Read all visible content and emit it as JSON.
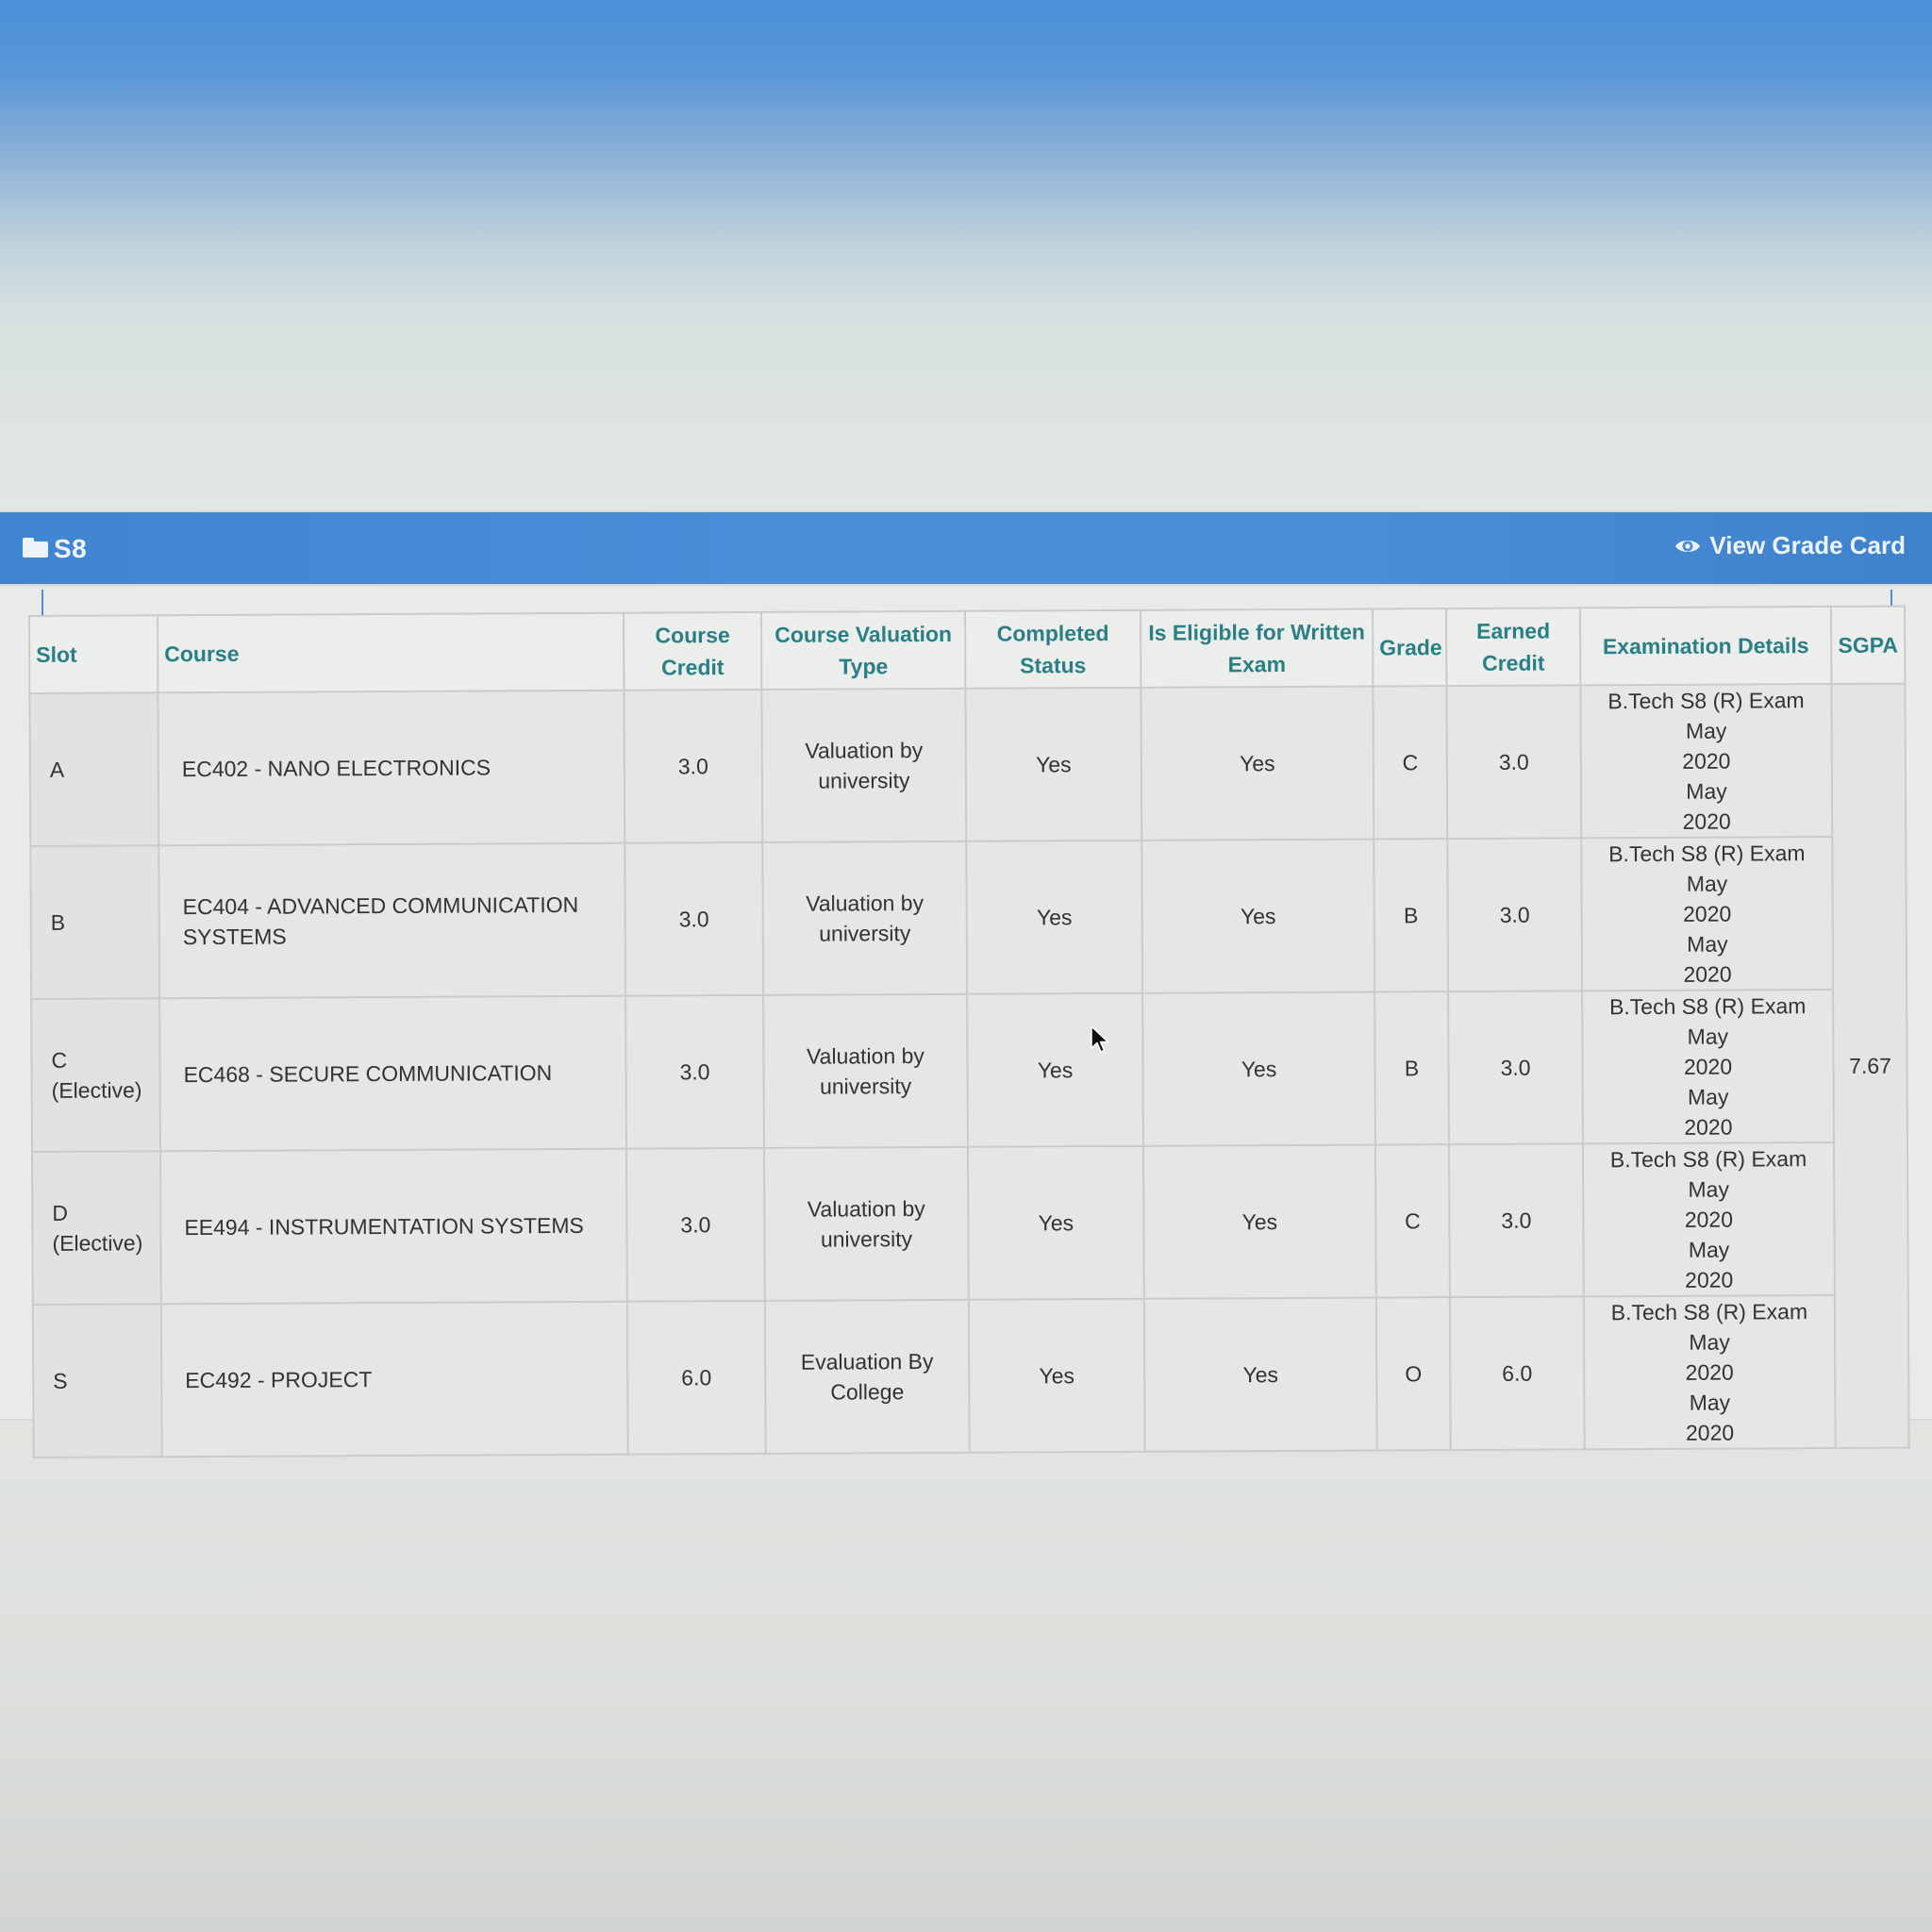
{
  "panel": {
    "title": "S8",
    "view_link": "View Grade Card"
  },
  "table": {
    "headers": {
      "slot": "Slot",
      "course": "Course",
      "course_credit": "Course Credit",
      "valuation_type": "Course Valuation Type",
      "completed_status": "Completed Status",
      "eligible": "Is Eligible for Written Exam",
      "grade": "Grade",
      "earned_credit": "Earned Credit",
      "exam_details": "Examination Details",
      "sgpa": "SGPA"
    },
    "sgpa": "7.67",
    "rows": [
      {
        "slot_code": "A",
        "slot_note": "",
        "course": "EC402 - NANO ELECTRONICS",
        "credit": "3.0",
        "valuation_line1": "Valuation by",
        "valuation_line2": "university",
        "completed": "Yes",
        "eligible": "Yes",
        "grade": "C",
        "earned": "3.0",
        "exam_line1": "B.Tech S8 (R) Exam May",
        "exam_line2": "2020",
        "exam_line3": "May",
        "exam_line4": "2020"
      },
      {
        "slot_code": "B",
        "slot_note": "",
        "course": "EC404 - ADVANCED COMMUNICATION SYSTEMS",
        "credit": "3.0",
        "valuation_line1": "Valuation by",
        "valuation_line2": "university",
        "completed": "Yes",
        "eligible": "Yes",
        "grade": "B",
        "earned": "3.0",
        "exam_line1": "B.Tech S8 (R) Exam May",
        "exam_line2": "2020",
        "exam_line3": "May",
        "exam_line4": "2020"
      },
      {
        "slot_code": "C",
        "slot_note": "(Elective)",
        "course": "EC468 - SECURE COMMUNICATION",
        "credit": "3.0",
        "valuation_line1": "Valuation by",
        "valuation_line2": "university",
        "completed": "Yes",
        "eligible": "Yes",
        "grade": "B",
        "earned": "3.0",
        "exam_line1": "B.Tech S8 (R) Exam May",
        "exam_line2": "2020",
        "exam_line3": "May",
        "exam_line4": "2020"
      },
      {
        "slot_code": "D",
        "slot_note": "(Elective)",
        "course": "EE494 - INSTRUMENTATION SYSTEMS",
        "credit": "3.0",
        "valuation_line1": "Valuation by",
        "valuation_line2": "university",
        "completed": "Yes",
        "eligible": "Yes",
        "grade": "C",
        "earned": "3.0",
        "exam_line1": "B.Tech S8 (R) Exam May",
        "exam_line2": "2020",
        "exam_line3": "May",
        "exam_line4": "2020"
      },
      {
        "slot_code": "S",
        "slot_note": "",
        "course": "EC492 - PROJECT",
        "credit": "6.0",
        "valuation_line1": "Evaluation By",
        "valuation_line2": "College",
        "completed": "Yes",
        "eligible": "Yes",
        "grade": "O",
        "earned": "6.0",
        "exam_line1": "B.Tech S8 (R) Exam May",
        "exam_line2": "2020",
        "exam_line3": "May",
        "exam_line4": "2020"
      }
    ]
  },
  "icons": {
    "panel_icon": "folder-icon",
    "view_icon": "eye-icon",
    "pointer": "mouse-cursor-icon"
  }
}
